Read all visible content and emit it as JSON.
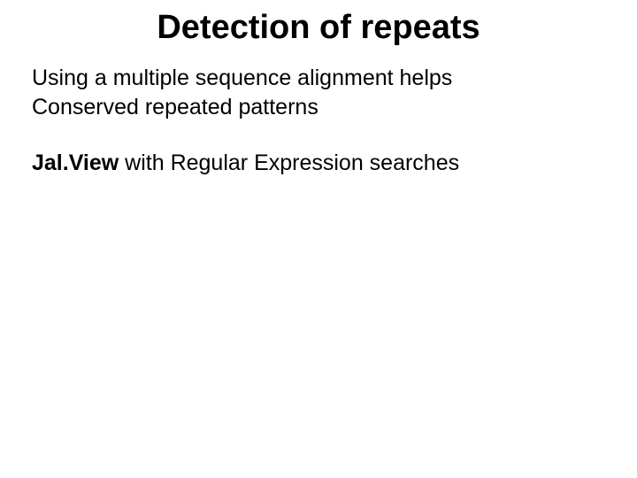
{
  "title": "Detection of repeats",
  "para1_line1": "Using a multiple sequence alignment helps",
  "para1_line2": "Conserved repeated patterns",
  "para2_bold": "Jal.View",
  "para2_rest": " with Regular Expression searches"
}
